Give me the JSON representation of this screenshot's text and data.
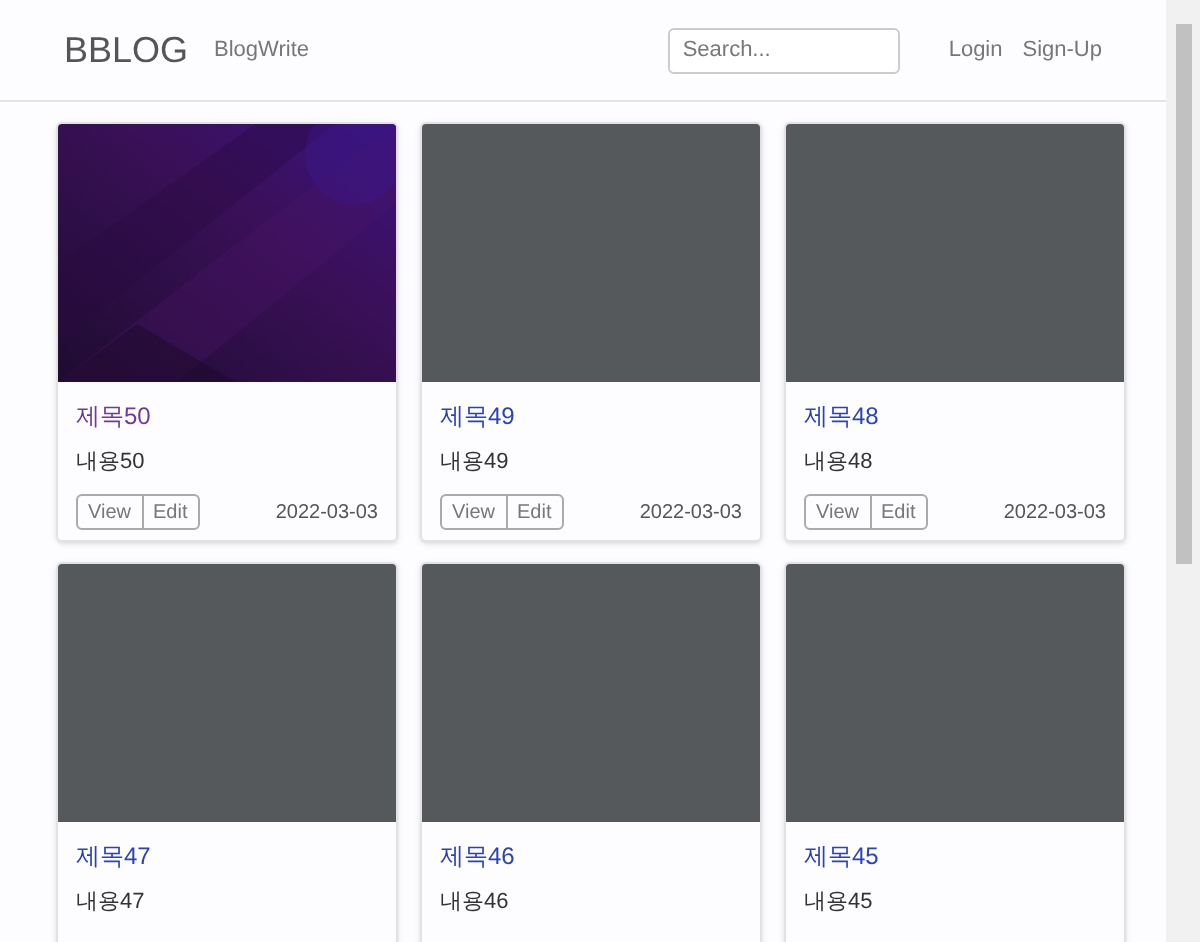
{
  "navbar": {
    "brand": "BBLOG",
    "links": [
      "BlogWrite"
    ],
    "search": {
      "placeholder": "Search..."
    },
    "auth_links": [
      "Login",
      "Sign-Up"
    ]
  },
  "posts": [
    {
      "kind": "picture",
      "title": "제목50",
      "visited": true,
      "body": "내용50",
      "buttons": [
        "View",
        "Edit"
      ],
      "date": "2022-03-03"
    },
    {
      "kind": "placeholder",
      "title": "제목49",
      "visited": false,
      "body": "내용49",
      "buttons": [
        "View",
        "Edit"
      ],
      "date": "2022-03-03"
    },
    {
      "kind": "placeholder",
      "title": "제목48",
      "visited": false,
      "body": "내용48",
      "buttons": [
        "View",
        "Edit"
      ],
      "date": "2022-03-03"
    },
    {
      "kind": "placeholder",
      "title": "제목47",
      "visited": false,
      "body": "내용47"
    },
    {
      "kind": "placeholder",
      "title": "제목46",
      "visited": false,
      "body": "내용46"
    },
    {
      "kind": "placeholder",
      "title": "제목45",
      "visited": false,
      "body": "내용45"
    }
  ]
}
